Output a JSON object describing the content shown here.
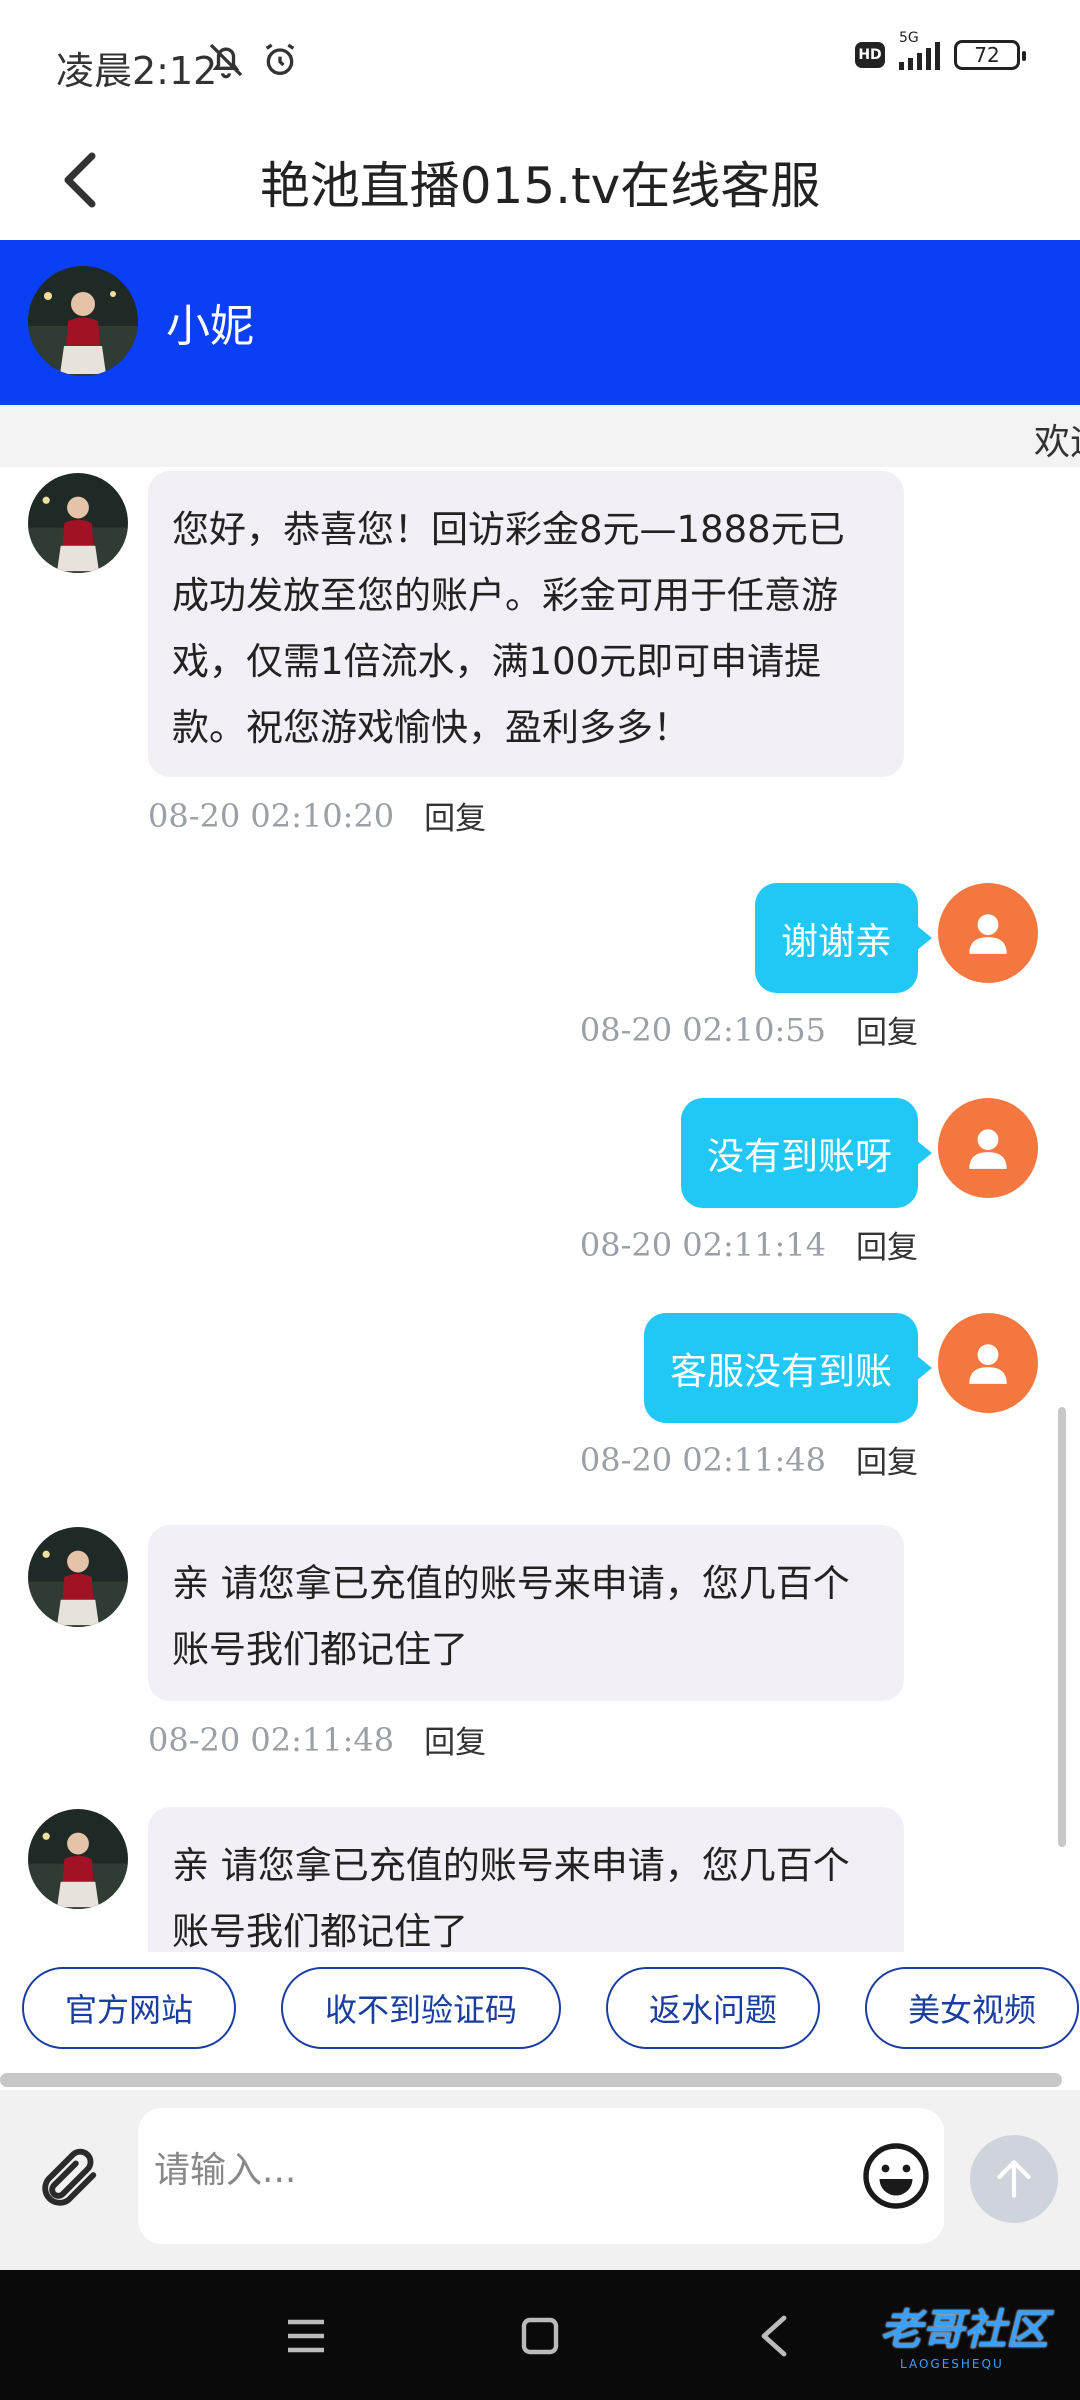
{
  "status_bar": {
    "time": "凌晨2:12",
    "network": "5G",
    "battery": "72"
  },
  "header": {
    "title": "艳池直播015.tv在线客服"
  },
  "agent": {
    "name": "小妮"
  },
  "marquee": {
    "text": "欢迎"
  },
  "messages": [
    {
      "sender": "agent",
      "text": "您好，恭喜您！回访彩金8元—1888元已成功发放至您的账户。彩金可用于任意游戏，仅需1倍流水，满100元即可申请提款。祝您游戏愉快，盈利多多！",
      "time": "08-20 02:10:20",
      "reply": "回复"
    },
    {
      "sender": "user",
      "text": "谢谢亲",
      "time": "08-20 02:10:55",
      "reply": "回复"
    },
    {
      "sender": "user",
      "text": "没有到账呀",
      "time": "08-20 02:11:14",
      "reply": "回复"
    },
    {
      "sender": "user",
      "text": "客服没有到账",
      "time": "08-20 02:11:48",
      "reply": "回复"
    },
    {
      "sender": "agent",
      "text": "亲  请您拿已充值的账号来申请，您几百个账号我们都记住了",
      "time": "08-20 02:11:48",
      "reply": "回复"
    },
    {
      "sender": "agent",
      "text": "亲 请您拿已充值的账号来申请，您几百个账号我们都记住了"
    }
  ],
  "quick_replies": [
    "官方网站",
    "收不到验证码",
    "返水问题",
    "美女视频"
  ],
  "input": {
    "placeholder": "请输入..."
  },
  "watermark": {
    "main": "老哥社区",
    "sub": "LAOGESHEQU"
  },
  "colors": {
    "agent_banner": "#0b3ff5",
    "user_bubble": "#22c8f5",
    "agent_bubble": "#f2eff7",
    "user_avatar": "#f4773f",
    "chip_border": "#1a3da0"
  }
}
